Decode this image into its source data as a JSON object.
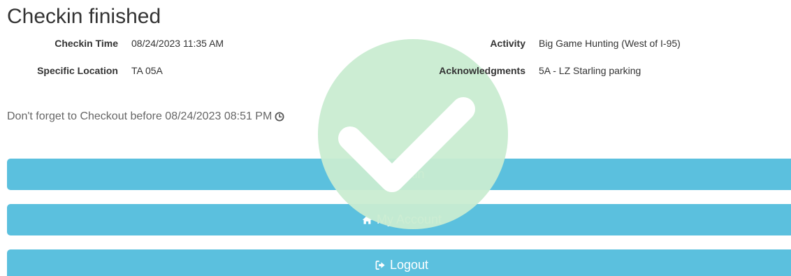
{
  "page": {
    "title": "Checkin finished"
  },
  "checkin": {
    "time_label": "Checkin Time",
    "time_value": "08/24/2023 11:35 AM",
    "location_label": "Specific Location",
    "location_value": "TA 05A",
    "activity_label": "Activity",
    "activity_value": "Big Game Hunting (West of I-95)",
    "ack_label": "Acknowledgments",
    "ack_value": "5A - LZ Starling parking"
  },
  "reminder": {
    "text": "Don't forget to Checkout before 08/24/2023 08:51 PM",
    "icon": "clock-icon"
  },
  "buttons": {
    "checkin_label": "Checkin",
    "account_label": "My Account",
    "account_icon": "home-icon",
    "logout_label": "Logout",
    "logout_icon": "logout-icon"
  },
  "colors": {
    "button_bg": "#5bc0de",
    "success_circle": "#c9ecd1",
    "text": "#333333",
    "muted_text": "#666666"
  }
}
